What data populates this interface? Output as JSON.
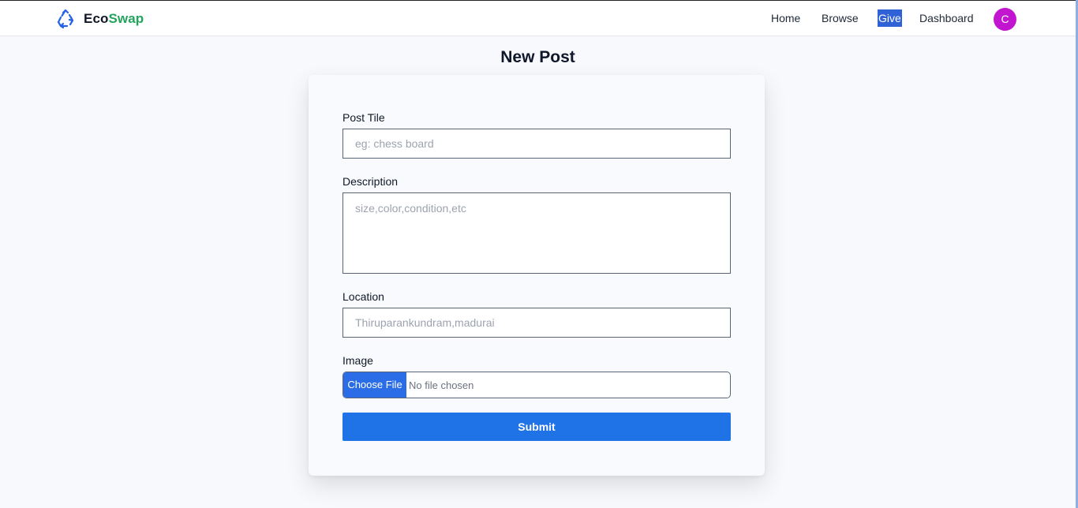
{
  "brand": {
    "name_part1": "Eco",
    "name_part2": "Swap",
    "logo_icon": "recycle-icon",
    "colors": {
      "eco": "#111827",
      "swap": "#22a45d",
      "logo": "#2563eb"
    }
  },
  "nav": {
    "items": [
      {
        "label": "Home"
      },
      {
        "label": "Browse"
      },
      {
        "label": "Give",
        "active": true
      },
      {
        "label": "Dashboard"
      }
    ],
    "avatar_initial": "C",
    "avatar_color": "#c115cf",
    "active_color": "#2f62d6"
  },
  "page": {
    "title": "New Post"
  },
  "form": {
    "title_label": "Post Tile",
    "title_placeholder": "eg: chess board",
    "description_label": "Description",
    "description_placeholder": "size,color,condition,etc",
    "location_label": "Location",
    "location_placeholder": "Thiruparankundram,madurai",
    "image_label": "Image",
    "file_button_label": "Choose File",
    "file_status": "No file chosen",
    "submit_label": "Submit",
    "accent_color": "#1f73e6"
  }
}
